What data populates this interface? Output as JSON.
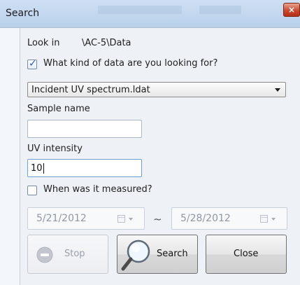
{
  "window": {
    "title": "Search"
  },
  "look_in": {
    "label": "Look in",
    "path": "\\AC-5\\Data"
  },
  "data_kind": {
    "label": "What kind of data are you  looking for?",
    "checked": true,
    "selected": "Incident UV spectrum.ldat"
  },
  "sample_name": {
    "label": "Sample name",
    "value": ""
  },
  "uv_intensity": {
    "label": "UV intensity",
    "value": "10"
  },
  "measured": {
    "label": "When was it measured?",
    "checked": false,
    "from": "5/21/2012",
    "separator": "~",
    "to": "5/28/2012"
  },
  "buttons": {
    "stop": "Stop",
    "search": "Search",
    "close": "Close"
  },
  "colors": {
    "titlebar": "#c2d6ee",
    "accent": "#2a5bd7",
    "close": "#c8442a"
  },
  "icons": [
    "close-icon",
    "checkmark-icon",
    "dropdown-arrow-icon",
    "calendar-icon",
    "stop-icon",
    "magnifier-icon"
  ]
}
